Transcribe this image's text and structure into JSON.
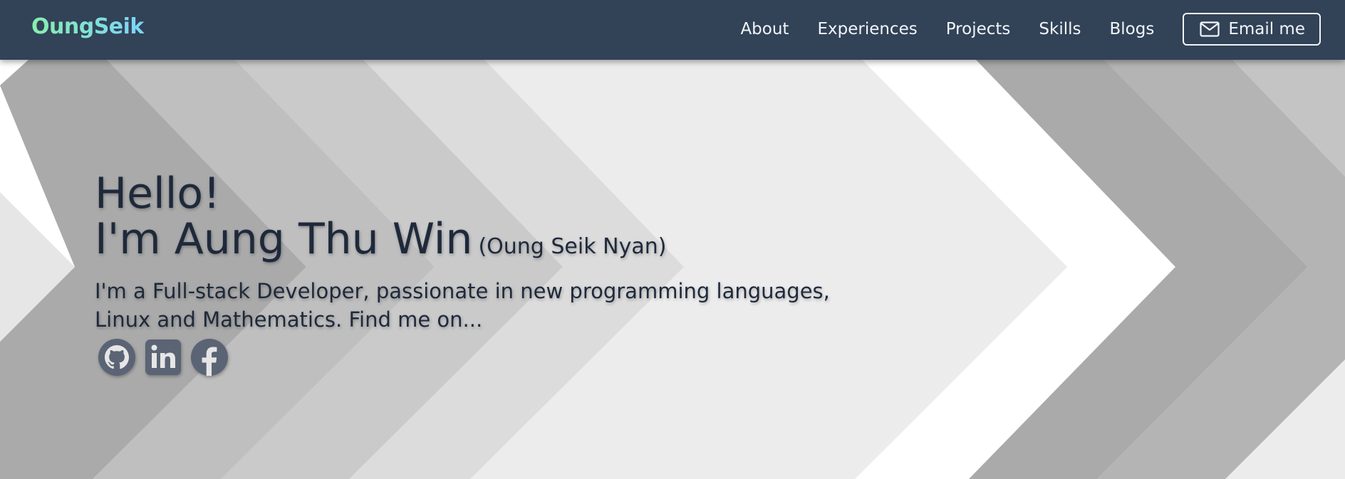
{
  "brand": {
    "name": "OungSeik"
  },
  "nav": {
    "items": [
      {
        "label": "About"
      },
      {
        "label": "Experiences"
      },
      {
        "label": "Projects"
      },
      {
        "label": "Skills"
      },
      {
        "label": "Blogs"
      }
    ],
    "email_button": {
      "label": "Email me",
      "icon": "mail-icon"
    }
  },
  "hero": {
    "greeting": "Hello!",
    "name_prefix": "I'm Aung Thu Win",
    "alias": "(Oung Seik Nyan)",
    "bio_line1": "I'm a Full-stack Developer, passionate in new programming languages,",
    "bio_line2": "Linux and Mathematics. Find me on...",
    "socials": [
      {
        "icon": "github-icon"
      },
      {
        "icon": "linkedin-icon"
      },
      {
        "icon": "facebook-icon"
      }
    ]
  },
  "colors": {
    "navbar": "#324257",
    "brand_gradient_start": "#86efac",
    "brand_gradient_end": "#7dd3fc",
    "nav_text": "#f1f5f9",
    "hero_text": "#1e293b",
    "social_icon": "#5a6474"
  }
}
